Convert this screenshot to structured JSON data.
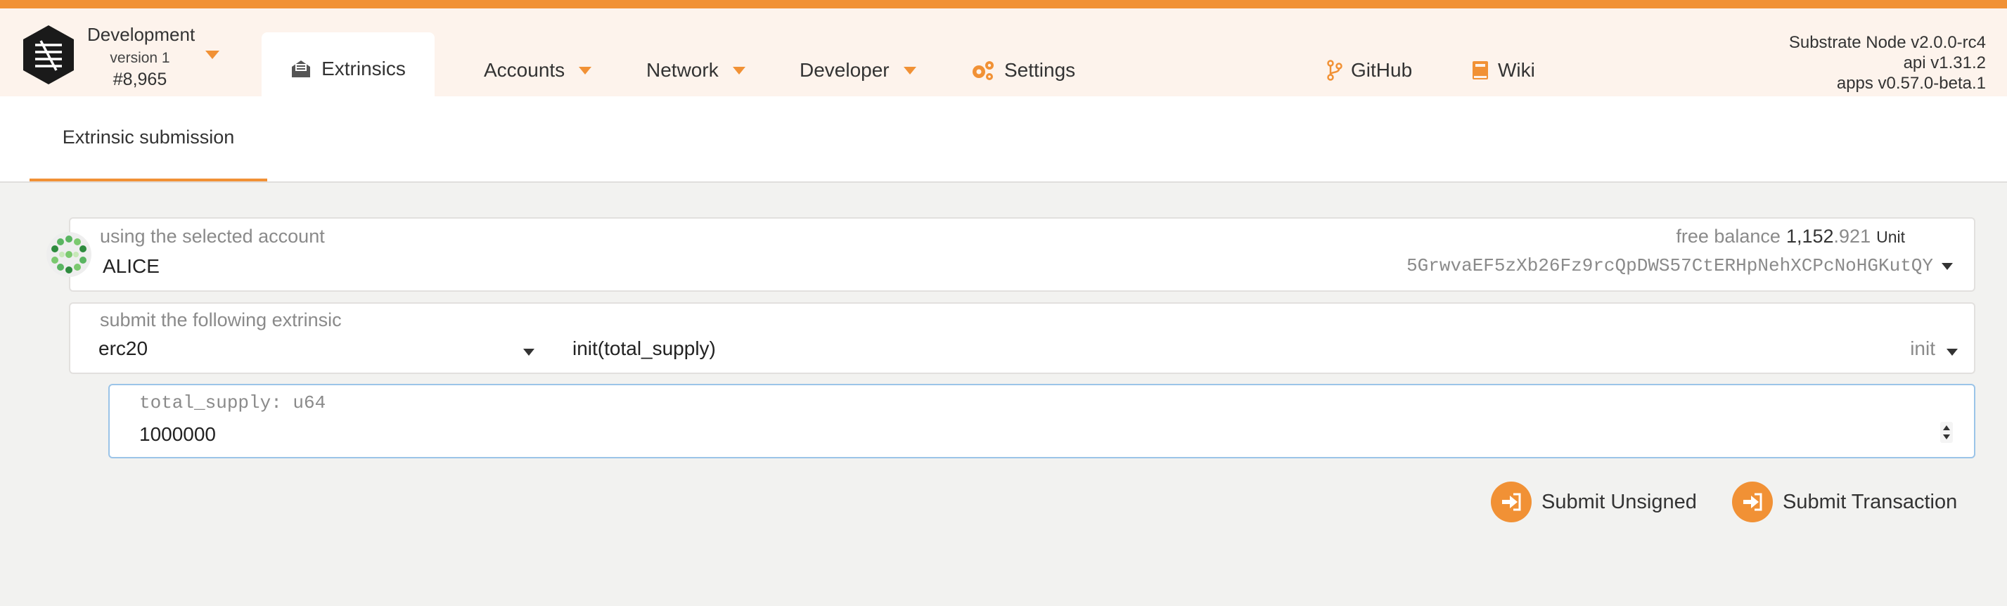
{
  "theme": {
    "accent": "#f19135",
    "menu_bg": "#fdf3ec",
    "page_bg": "#f2f2f0",
    "focus_border": "#9bc4e8"
  },
  "chain": {
    "name": "Development",
    "version": "version 1",
    "block": "#8,965"
  },
  "nav": {
    "active_tab": {
      "label": "Extrinsics",
      "icon": "envelope-open-icon"
    },
    "items": [
      {
        "label": "Accounts",
        "has_caret": true
      },
      {
        "label": "Network",
        "has_caret": true
      },
      {
        "label": "Developer",
        "has_caret": true
      },
      {
        "label": "Settings",
        "icon": "cogs-icon"
      },
      {
        "label": "GitHub",
        "icon": "code-branch-icon"
      },
      {
        "label": "Wiki",
        "icon": "book-icon"
      }
    ]
  },
  "node": {
    "name": "Substrate Node v2.0.0-rc4",
    "api": "api v1.31.2",
    "apps": "apps v0.57.0-beta.1"
  },
  "subnav": {
    "tab": "Extrinsic submission"
  },
  "account": {
    "label": "using the selected account",
    "name": "ALICE",
    "balance_label": "free balance",
    "balance_main": "1,152",
    "balance_decimals": ".921",
    "balance_unit": "Unit",
    "address": "5GrwvaEF5zXb26Fz9rcQpDWS57CtERHpNehXCPcNoHGKutQY"
  },
  "extrinsic": {
    "label": "submit the following extrinsic",
    "module": "erc20",
    "call_signature": "init(total_supply)",
    "call": "init"
  },
  "param": {
    "label": "total_supply: u64",
    "value": "1000000"
  },
  "actions": {
    "submit_unsigned": "Submit Unsigned",
    "submit_transaction": "Submit Transaction"
  }
}
